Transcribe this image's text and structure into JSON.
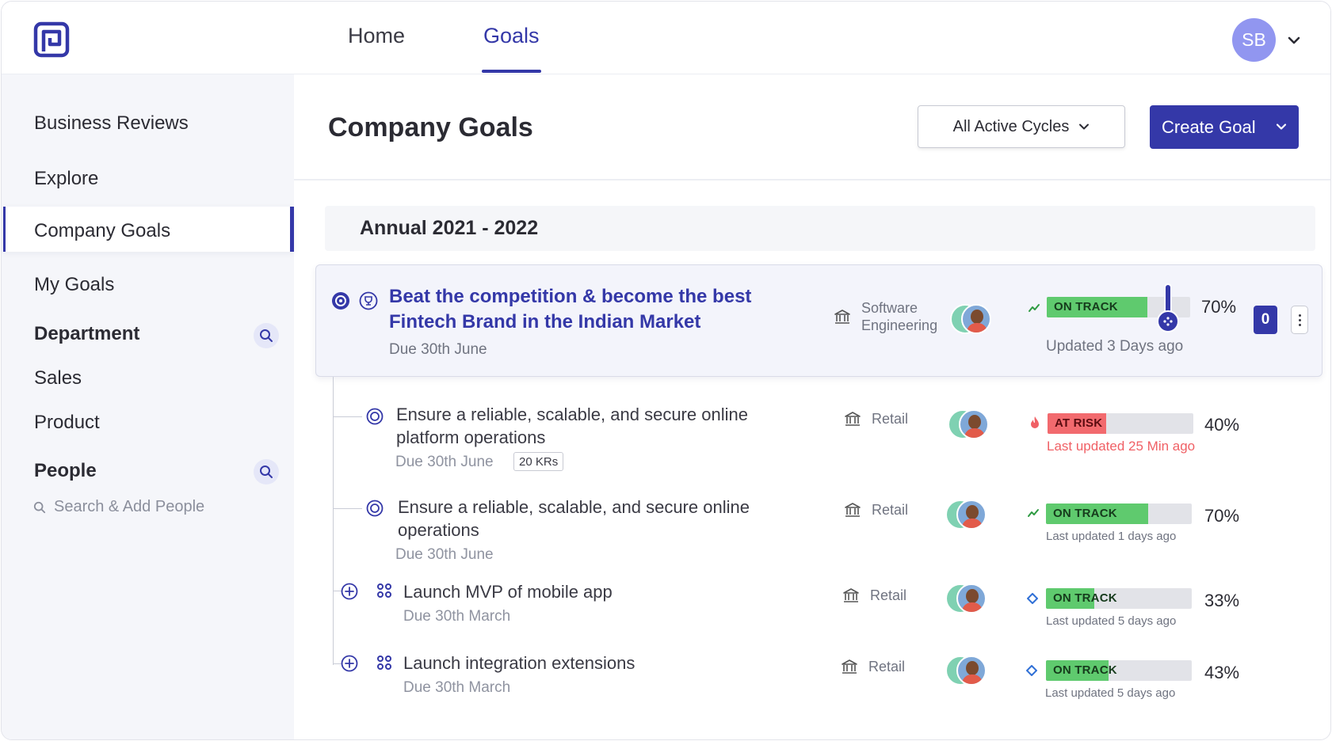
{
  "header": {
    "nav": [
      {
        "label": "Home"
      },
      {
        "label": "Goals"
      }
    ],
    "user_initials": "SB"
  },
  "sidebar": {
    "items": {
      "business_reviews": "Business Reviews",
      "explore": "Explore",
      "company_goals": "Company Goals",
      "my_goals": "My Goals",
      "department": "Department",
      "sales": "Sales",
      "product": "Product",
      "people": "People"
    },
    "people_search_placeholder": "Search & Add People"
  },
  "main": {
    "title": "Company Goals",
    "cycle_filter": "All Active Cycles",
    "create_button": "Create Goal",
    "cycle_header": "Annual 2021 - 2022",
    "goal": {
      "title": "Beat the competition & become the best Fintech Brand in the Indian Market",
      "due": "Due 30th June",
      "team": "Software Engineering",
      "status": "ON TRACK",
      "progress": 70,
      "progress_label": "70%",
      "updated": "Updated 3 Days ago",
      "count": "0"
    },
    "sub_goals": [
      {
        "title": "Ensure a reliable, scalable, and secure online platform operations",
        "due": "Due 30th June",
        "krs": "20 KRs",
        "team": "Retail",
        "status": "AT RISK",
        "progress": 40,
        "progress_label": "40%",
        "updated": "Last updated 25 Min ago"
      },
      {
        "title": "Ensure a reliable, scalable, and secure online operations",
        "due": "Due 30th June",
        "team": "Retail",
        "status": "ON TRACK",
        "progress": 70,
        "progress_label": "70%",
        "updated": "Last updated  1 days ago"
      },
      {
        "title": "Launch MVP of mobile app",
        "due": "Due 30th March",
        "team": "Retail",
        "status": "ON TRACK",
        "progress": 33,
        "progress_label": "33%",
        "updated": "Last updated  5 days ago"
      },
      {
        "title": "Launch integration extensions",
        "due": "Due 30th March",
        "team": "Retail",
        "status": "ON TRACK",
        "progress": 43,
        "progress_label": "43%",
        "updated": "Last updated  5 days ago"
      }
    ]
  },
  "colors": {
    "brand": "#3438a8",
    "on_track": "#5fca6e",
    "at_risk": "#f26a6e",
    "avatar_bg": "#9196f0"
  },
  "icons": [
    "logo-icon",
    "chevron-down-icon",
    "search-icon",
    "target-icon",
    "trophy-icon",
    "bank-icon",
    "trend-up-icon",
    "fire-icon",
    "diamond-icon",
    "plus-circle-icon",
    "grid-icon",
    "kebab-icon"
  ]
}
